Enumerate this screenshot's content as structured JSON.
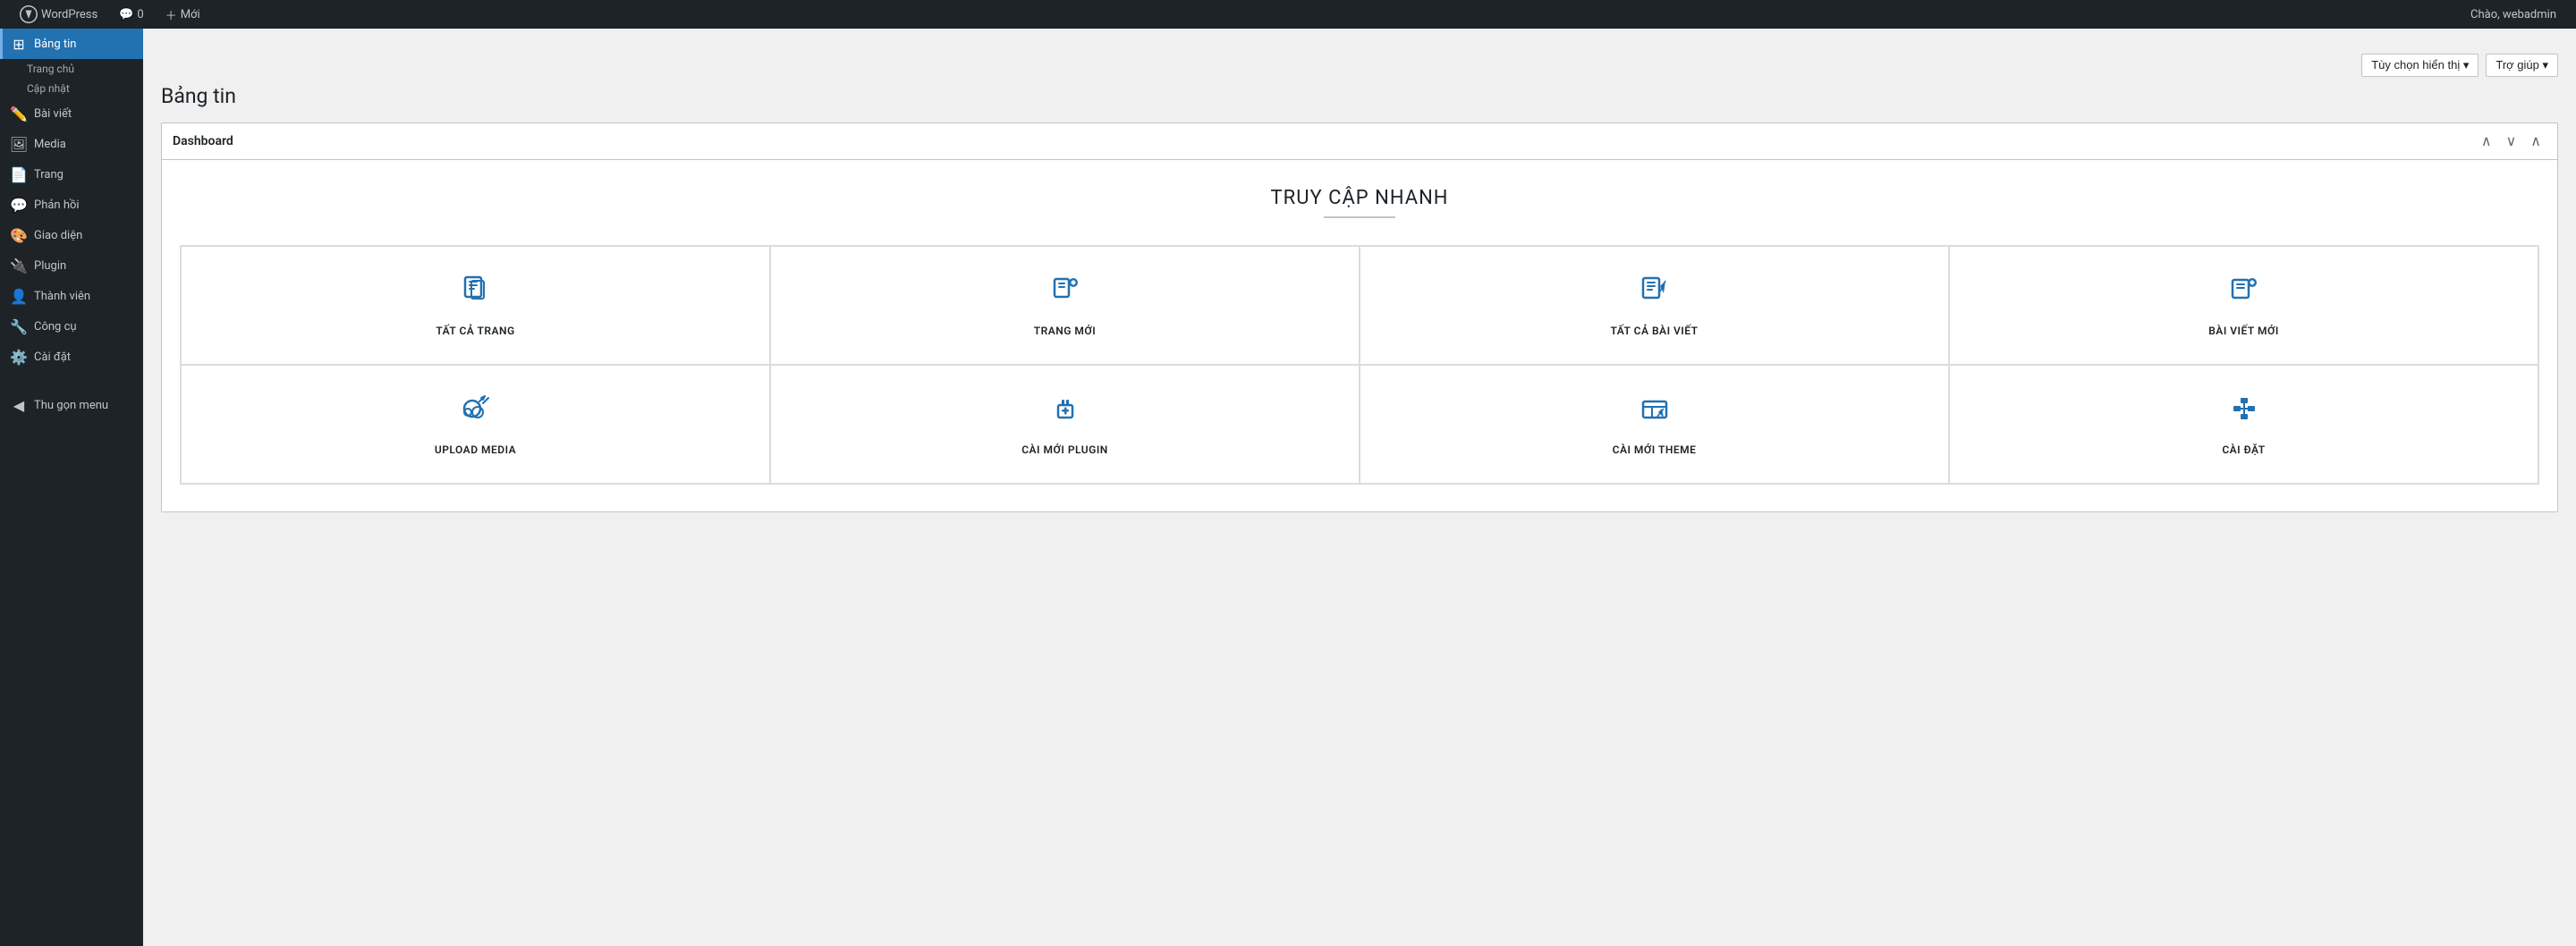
{
  "adminBar": {
    "wpLogoAlt": "WordPress",
    "siteName": "WordPress",
    "commentsLabel": "0",
    "newLabel": "Mới",
    "greeting": "Chào, webadmin",
    "screenOptions": "Tùy chọn hiển thị",
    "help": "Trợ giúp"
  },
  "sidebar": {
    "items": [
      {
        "id": "bang-tin",
        "label": "Bảng tin",
        "icon": "dashboard",
        "active": true
      },
      {
        "id": "trang-chu",
        "label": "Trang chủ",
        "sub": true
      },
      {
        "id": "cap-nhat",
        "label": "Cập nhật",
        "sub": true
      },
      {
        "id": "bai-viet",
        "label": "Bài viết",
        "icon": "edit"
      },
      {
        "id": "media",
        "label": "Media",
        "icon": "media"
      },
      {
        "id": "trang",
        "label": "Trang",
        "icon": "page"
      },
      {
        "id": "phan-hoi",
        "label": "Phản hồi",
        "icon": "comment"
      },
      {
        "id": "giao-dien",
        "label": "Giao diện",
        "icon": "appearance"
      },
      {
        "id": "plugin",
        "label": "Plugin",
        "icon": "plugin"
      },
      {
        "id": "thanh-vien",
        "label": "Thành viên",
        "icon": "users"
      },
      {
        "id": "cong-cu",
        "label": "Công cụ",
        "icon": "tools"
      },
      {
        "id": "cai-dat",
        "label": "Cài đặt",
        "icon": "settings"
      }
    ],
    "collapseLabel": "Thu gọn menu"
  },
  "header": {
    "pageTitle": "Bảng tin",
    "screenOptionsLabel": "Tùy chọn hiển thị ▾",
    "helpLabel": "Trợ giúp ▾"
  },
  "dashboard": {
    "panelTitle": "Dashboard",
    "quickAccessTitle": "TRUY CẬP NHANH",
    "items": [
      {
        "id": "tat-ca-trang",
        "label": "TẤT CẢ TRANG",
        "icon": "pages"
      },
      {
        "id": "trang-moi",
        "label": "TRANG MỚI",
        "icon": "new-page"
      },
      {
        "id": "tat-ca-bai-viet",
        "label": "TẤT CẢ BÀI VIẾT",
        "icon": "all-posts"
      },
      {
        "id": "bai-viet-moi",
        "label": "BÀI VIẾT MỚI",
        "icon": "new-post"
      },
      {
        "id": "upload-media",
        "label": "UPLOAD MEDIA",
        "icon": "upload"
      },
      {
        "id": "cai-moi-plugin",
        "label": "CÀI MỚI PLUGIN",
        "icon": "plugin-add"
      },
      {
        "id": "cai-moi-theme",
        "label": "CÀI MỚI THEME",
        "icon": "theme-add"
      },
      {
        "id": "cai-dat",
        "label": "CÀI ĐẶT",
        "icon": "settings-icon"
      }
    ]
  }
}
